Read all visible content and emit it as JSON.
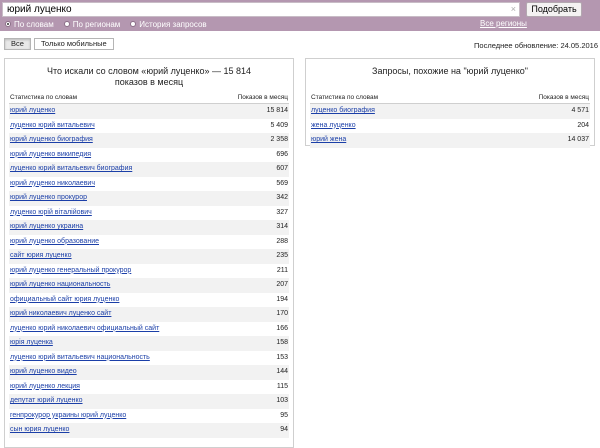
{
  "search": {
    "query": "юрий луценко",
    "button_label": "Подобрать",
    "clear_icon": "×",
    "modes": [
      {
        "label": "По словам",
        "selected": true
      },
      {
        "label": "По регионам",
        "selected": false
      },
      {
        "label": "История запросов",
        "selected": false
      }
    ],
    "regions_link": "Все регионы"
  },
  "tabs": [
    {
      "label": "Все",
      "active": true
    },
    {
      "label": "Только мобильные",
      "active": false
    }
  ],
  "last_update": "Последнее обновление: 24.05.2016",
  "left_panel": {
    "title": "Что искали со словом «юрий луценко» — 15 814 показов в месяц",
    "col_stats": "Статистика по словам",
    "col_shows": "Показов в месяц",
    "rows": [
      {
        "phrase": "юрий луценко",
        "count": "15 814"
      },
      {
        "phrase": "луценко юрий витальевич",
        "count": "5 409"
      },
      {
        "phrase": "юрий луценко биография",
        "count": "2 358"
      },
      {
        "phrase": "юрий луценко википедия",
        "count": "696"
      },
      {
        "phrase": "луценко юрий витальевич биография",
        "count": "607"
      },
      {
        "phrase": "юрий луценко николаевич",
        "count": "569"
      },
      {
        "phrase": "юрий луценко прокурор",
        "count": "342"
      },
      {
        "phrase": "луценко юрій віталійович",
        "count": "327"
      },
      {
        "phrase": "юрий луценко украина",
        "count": "314"
      },
      {
        "phrase": "юрий луценко образование",
        "count": "288"
      },
      {
        "phrase": "сайт юрия луценко",
        "count": "235"
      },
      {
        "phrase": "юрий луценко генеральный прокурор",
        "count": "211"
      },
      {
        "phrase": "юрий луценко национальность",
        "count": "207"
      },
      {
        "phrase": "официальный сайт юрия луценко",
        "count": "194"
      },
      {
        "phrase": "юрий николаевич луценко сайт",
        "count": "170"
      },
      {
        "phrase": "луценко юрий николаевич официальный сайт",
        "count": "166"
      },
      {
        "phrase": "юрія луценка",
        "count": "158"
      },
      {
        "phrase": "луценко юрий витальевич национальность",
        "count": "153"
      },
      {
        "phrase": "юрий луценко видео",
        "count": "144"
      },
      {
        "phrase": "юрий луценко лекция",
        "count": "115"
      },
      {
        "phrase": "депутат юрий луценко",
        "count": "103"
      },
      {
        "phrase": "генпрокурор украины юрий луценко",
        "count": "95"
      },
      {
        "phrase": "сын юрия луценко",
        "count": "94"
      }
    ]
  },
  "right_panel": {
    "title": "Запросы, похожие на \"юрий луценко\"",
    "col_stats": "Статистика по словам",
    "col_shows": "Показов в месяц",
    "rows": [
      {
        "phrase": "луценко биография",
        "count": "4 571"
      },
      {
        "phrase": "жена луценко",
        "count": "204"
      },
      {
        "phrase": "юрий жена",
        "count": "14 037"
      }
    ]
  }
}
